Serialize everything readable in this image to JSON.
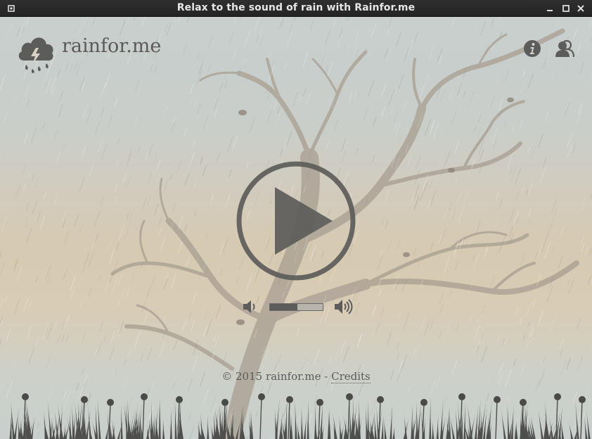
{
  "window": {
    "title": "Relax to the sound of rain with Rainfor.me"
  },
  "header": {
    "logo_text": "rainfor.me",
    "logo_icon": "rain-cloud-icon",
    "info_icon": "info-icon",
    "users_icon": "users-icon"
  },
  "player": {
    "play_icon": "play-icon",
    "volume_level": 0.52,
    "volume_down_icon": "volume-down-icon",
    "volume_up_icon": "volume-up-icon"
  },
  "footer": {
    "copyright": "© 2015 rainfor.me -",
    "credits_label": "Credits"
  },
  "colors": {
    "icon": "#5c5c5a",
    "text": "#5a5a58",
    "tree": "#a89e91"
  }
}
